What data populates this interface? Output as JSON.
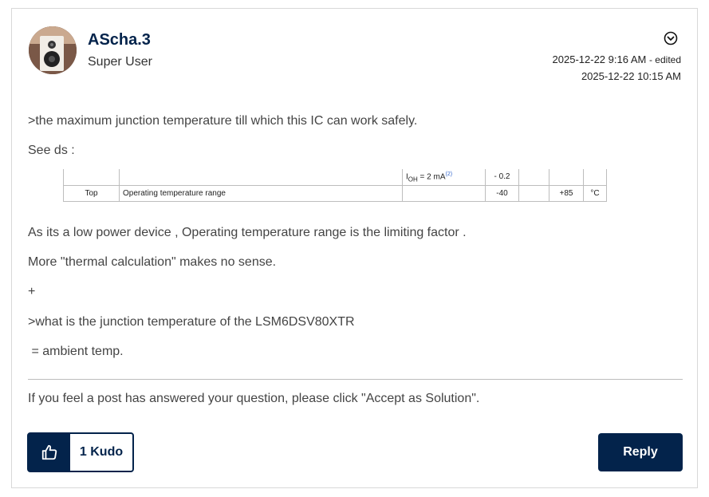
{
  "post": {
    "author": "AScha.3",
    "rank": "Super User",
    "date_posted": "2025-12-22 9:16 AM",
    "edited_label": "- edited",
    "date_edited": "2025-12-22 10:15 AM"
  },
  "body": {
    "p1": ">the maximum junction temperature till which this IC can work safely.",
    "p2": "See ds :",
    "p3": "As its a low power device , Operating temperature range is the limiting factor .",
    "p4": "More \"thermal calculation\" makes no sense.",
    "p5": "+",
    "p6": ">what is the junction temperature of the LSM6DSV80XTR",
    "p7": " = ambient temp."
  },
  "datasheet_table": {
    "row1": {
      "symbol": "",
      "parameter": "",
      "condition_main": "I",
      "condition_sub": "OH",
      "condition_rest": " = 2 mA",
      "condition_ref": "(2)",
      "min": "- 0.2",
      "typ": "",
      "max": "",
      "unit": ""
    },
    "row2": {
      "symbol": "Top",
      "parameter": "Operating temperature range",
      "condition": "",
      "min": "-40",
      "typ": "",
      "max": "+85",
      "unit": "°C"
    }
  },
  "signature": "If you feel a post has answered your question, please click \"Accept as Solution\".",
  "actions": {
    "kudo_label": "1 Kudo",
    "reply_label": "Reply"
  },
  "colors": {
    "brand_navy": "#03234b",
    "border": "#d8d8d8"
  }
}
